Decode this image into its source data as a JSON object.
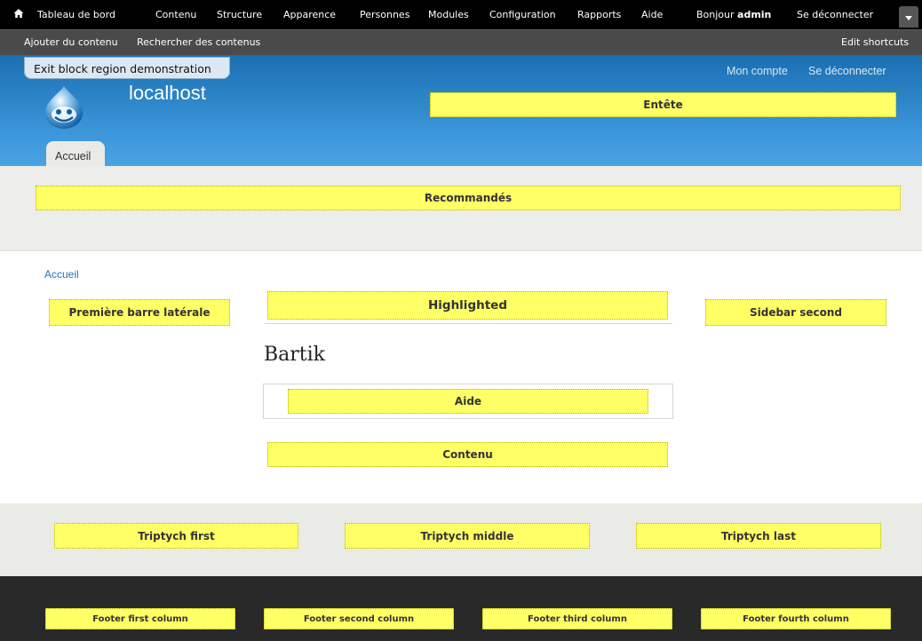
{
  "toolbar": {
    "menu": [
      "Tableau de bord",
      "Contenu",
      "Structure",
      "Apparence",
      "Personnes",
      "Modules",
      "Configuration",
      "Rapports",
      "Aide"
    ],
    "greeting_prefix": "Bonjour",
    "greeting_user": "admin",
    "logout": "Se déconnecter",
    "shortcuts": [
      "Ajouter du contenu",
      "Rechercher des contenus"
    ],
    "edit_shortcuts": "Edit shortcuts",
    "home_icon": "home-icon",
    "drawer_icon": "chevron-down-icon"
  },
  "header": {
    "exit_demo": "Exit block region demonstration",
    "site_name": "localhost",
    "secondary_menu": [
      "Mon compte",
      "Se déconnecter"
    ],
    "tab_home": "Accueil",
    "logo_icon": "drupal-drop-logo"
  },
  "regions": {
    "header": "Entête",
    "featured": "Recommandés",
    "sidebar_first": "Première barre latérale",
    "highlighted": "Highlighted",
    "sidebar_second": "Sidebar second",
    "help": "Aide",
    "content": "Contenu",
    "triptych_first": "Triptych first",
    "triptych_middle": "Triptych middle",
    "triptych_last": "Triptych last",
    "footer_first": "Footer first column",
    "footer_second": "Footer second column",
    "footer_third": "Footer third column",
    "footer_fourth": "Footer fourth column"
  },
  "main": {
    "breadcrumb": "Accueil",
    "title": "Bartik"
  },
  "colors": {
    "region_fill": "#ffff66",
    "header_blue": "#2a82c9",
    "link_blue": "#1f73b5",
    "footer_dark": "#292929"
  }
}
